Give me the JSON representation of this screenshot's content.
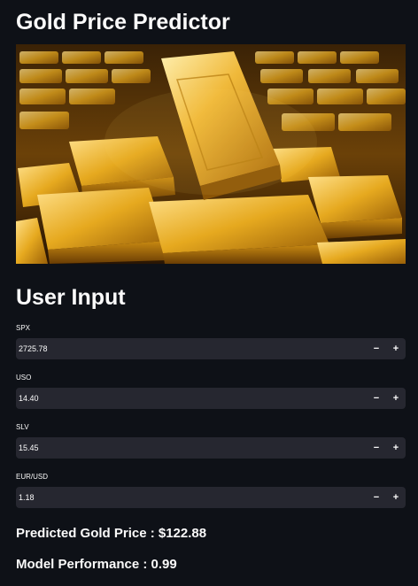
{
  "app": {
    "title": "Gold Price Predictor",
    "hero_image": "gold-bars-image"
  },
  "input_section": {
    "heading": "User Input",
    "fields": [
      {
        "label": "SPX",
        "value": "2725.78"
      },
      {
        "label": "USO",
        "value": "14.40"
      },
      {
        "label": "SLV",
        "value": "15.45"
      },
      {
        "label": "EUR/USD",
        "value": "1.18"
      }
    ],
    "decrement_label": "−",
    "increment_label": "+"
  },
  "results": {
    "prediction": "Predicted Gold Price : $122.88",
    "performance": "Model Performance : 0.99"
  },
  "colors": {
    "background": "#0e1117",
    "input_background": "#262730",
    "text": "#fafafa",
    "gold": "#d4a017"
  }
}
